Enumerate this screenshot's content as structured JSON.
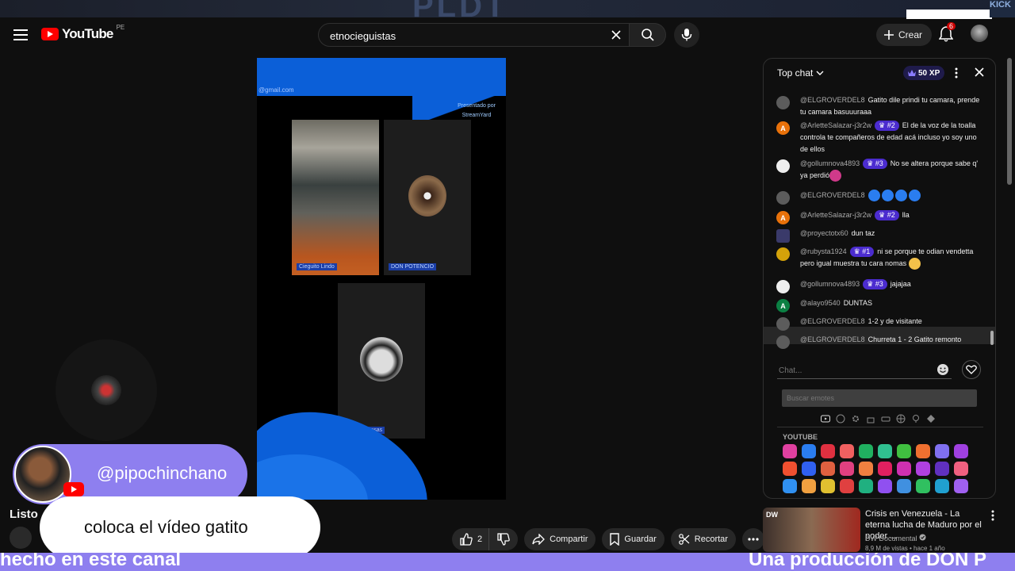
{
  "top_strip": {
    "ghost_text": "PLDT",
    "kick_text": "KICK"
  },
  "masthead": {
    "logo_text": "YouTube",
    "country_code": "PE",
    "search_value": "etnocieguistas",
    "create_label": "Crear",
    "notification_count": "6"
  },
  "video": {
    "email_text": "@gmail.com",
    "brand_text": "Presentado por StreamYard",
    "participants": [
      "Cieguito Lindo",
      "DON POTENCIO",
      "Paulo Sponsas"
    ]
  },
  "overlay": {
    "handle": "@pipochinchano",
    "message": "coloca el vídeo gatito"
  },
  "below_video": {
    "title_fragment": "Listo",
    "like_count": "2",
    "share_label": "Compartir",
    "save_label": "Guardar",
    "clip_label": "Recortar"
  },
  "ticker": {
    "left_text": "hecho en este canal",
    "right_text": "Una producción de DON P"
  },
  "chat": {
    "title": "Top chat",
    "xp_label": "50 XP",
    "messages": [
      {
        "author": "@ELGROVERDEL8",
        "rank": "",
        "text": "Gatito dile prindi tu camara, prende tu camara basuuuraaa",
        "avatar": "",
        "color": "#5c5c5c"
      },
      {
        "author": "@ArletteSalazar-j3r2w",
        "rank": "#2",
        "text": "El de la voz de la toalla controla te compañeros de edad acá incluso yo soy uno de ellos",
        "avatar": "A",
        "color": "#e8710a"
      },
      {
        "author": "@gollumnova4893",
        "rank": "#3",
        "text": "No se altera porque sabe q' ya perdió",
        "avatar": "",
        "color": "#eeeeee"
      },
      {
        "author": "@ELGROVERDEL8",
        "rank": "",
        "text": "",
        "avatar": "",
        "color": "#5c5c5c"
      },
      {
        "author": "@ArletteSalazar-j3r2w",
        "rank": "#2",
        "text": "lla",
        "avatar": "A",
        "color": "#e8710a"
      },
      {
        "author": "@proyectotx60",
        "rank": "",
        "text": "dun taz",
        "avatar": "",
        "color": "#3a3a6a"
      },
      {
        "author": "@rubysta1924",
        "rank": "#1",
        "text": "ni se porque te odian vendetta pero igual muestra tu cara nomas",
        "avatar": "",
        "color": "#d4a20a"
      },
      {
        "author": "@gollumnova4893",
        "rank": "#3",
        "text": "jajajaa",
        "avatar": "",
        "color": "#eeeeee"
      },
      {
        "author": "@alayo9540",
        "rank": "",
        "text": "DUNTAS",
        "avatar": "A",
        "color": "#0b8043"
      },
      {
        "author": "@ELGROVERDEL8",
        "rank": "",
        "text": "1-2 y de visitante",
        "avatar": "",
        "color": "#5c5c5c"
      },
      {
        "author": "@ELGROVERDEL8",
        "rank": "",
        "text": "Churreta 1 - 2 Gatito remonto",
        "avatar": "",
        "color": "#5c5c5c"
      }
    ],
    "input_placeholder": "Chat...",
    "emote_search_placeholder": "Buscar emotes",
    "emote_section_label": "YOUTUBE"
  },
  "recommendation": {
    "title": "Crisis en Venezuela - La eterna lucha de Maduro por el poder ...",
    "channel": "DW Documental",
    "meta": "8,9 M de vistas • hace 1 año",
    "thumb_badge": "DW"
  },
  "colors": {
    "accent_purple": "#8e7fef",
    "brand_red": "#ff0000",
    "rank_purple": "#4b2ccf",
    "video_blue": "#0b5fd8"
  }
}
